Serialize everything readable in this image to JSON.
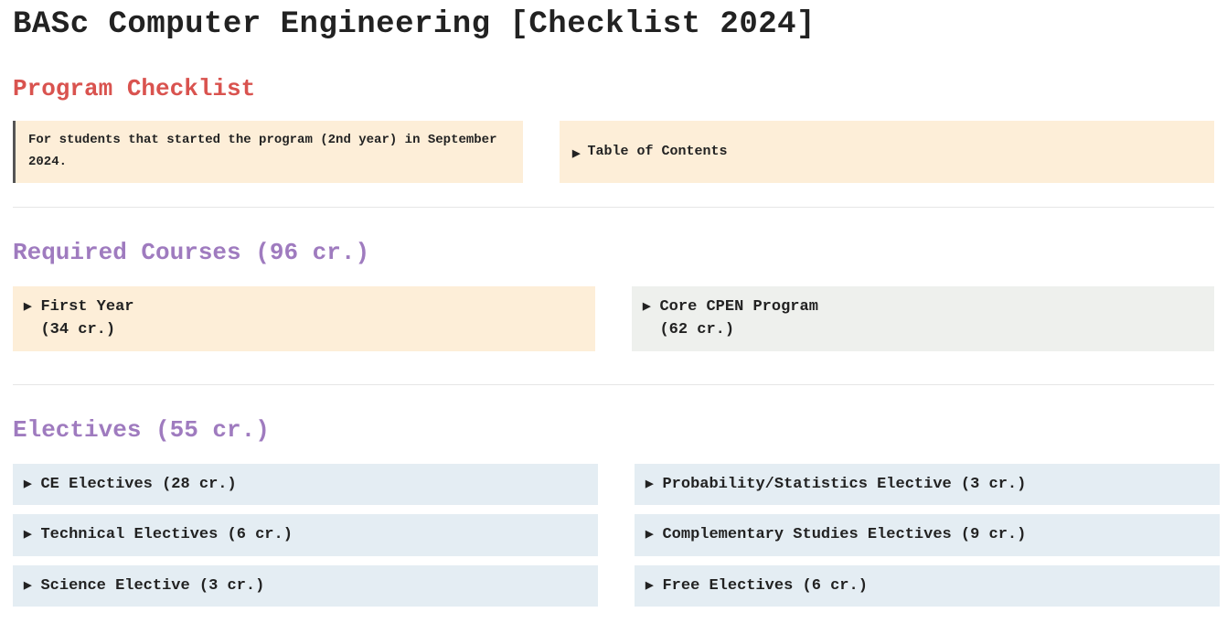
{
  "page_title": "BASc Computer Engineering [Checklist 2024]",
  "sections": {
    "program_checklist": {
      "heading": "Program Checklist",
      "info_note": "For students that started the program (2nd year) in September 2024.",
      "toc_label": "Table of Contents"
    },
    "required": {
      "heading": "Required Courses (96 cr.)",
      "first_year": "First Year\n(34 cr.)",
      "core_cpen": "Core CPEN Program\n(62 cr.)"
    },
    "electives": {
      "heading": "Electives (55 cr.)",
      "left": {
        "ce": "CE Electives (28 cr.)",
        "technical": "Technical Electives (6 cr.)",
        "science": "Science Elective (3 cr.)"
      },
      "right": {
        "prob": "Probability/Statistics Elective (3 cr.)",
        "comp": "Complementary Studies Electives (9 cr.)",
        "free": "Free Electives (6 cr.)"
      }
    }
  },
  "icons": {
    "triangle": "▶"
  }
}
